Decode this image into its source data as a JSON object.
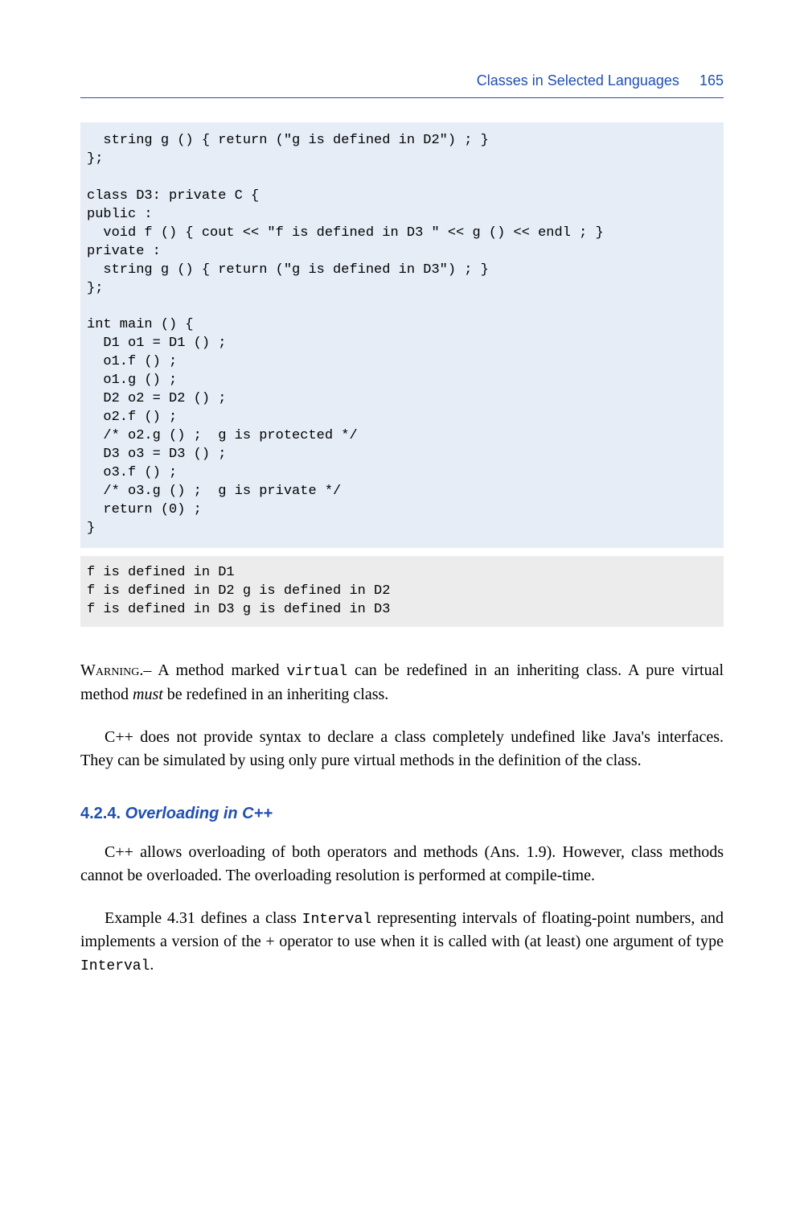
{
  "header": {
    "title": "Classes in Selected Languages",
    "page_number": "165"
  },
  "code1": {
    "lines": [
      "  string g () { return (\"g is defined in D2\") ; }",
      "};",
      "",
      "class D3: private C {",
      "public :",
      "  void f () { cout << \"f is defined in D3 \" << g () << endl ; }",
      "private :",
      "  string g () { return (\"g is defined in D3\") ; }",
      "};",
      "",
      "int main () {",
      "  D1 o1 = D1 () ;",
      "  o1.f () ;",
      "  o1.g () ;",
      "  D2 o2 = D2 () ;",
      "  o2.f () ;",
      "  /* o2.g () ;  g is protected */",
      "  D3 o3 = D3 () ;",
      "  o3.f () ;",
      "  /* o3.g () ;  g is private */",
      "  return (0) ;",
      "}"
    ]
  },
  "output1": {
    "lines": [
      "f is defined in D1",
      "f is defined in D2 g is defined in D2",
      "f is defined in D3 g is defined in D3"
    ]
  },
  "warning": {
    "label": "Warning",
    "part1": ".– A method marked ",
    "kw": "virtual",
    "part2": " can be redefined in an inheriting class. A pure virtual method ",
    "must": "must",
    "part3": " be redefined in an inheriting class."
  },
  "para2": "C++ does not provide syntax to declare a class completely undefined like Java's interfaces. They can be simulated by using only pure virtual methods in the definition of the class.",
  "section": {
    "number": "4.2.4.",
    "title": "Overloading in C++"
  },
  "para3": "C++ allows overloading of both operators and methods (Ans. 1.9). However, class methods cannot be overloaded. The overloading resolution is performed at compile-time.",
  "para4": {
    "part1": "Example 4.31 defines a class ",
    "kw1": "Interval",
    "part2": " representing intervals of floating-point numbers, and implements a version of the + operator to use when it is called with (at least) one argument of type ",
    "kw2": "Interval",
    "part3": "."
  }
}
